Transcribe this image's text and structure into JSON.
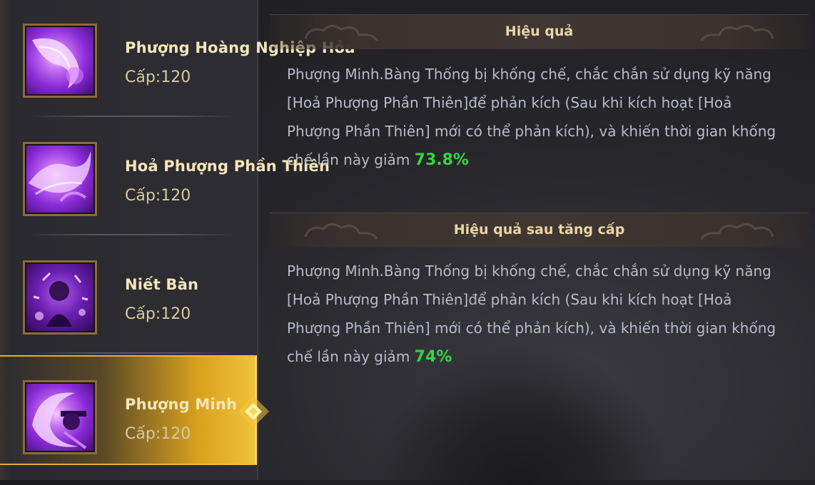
{
  "skills": [
    {
      "name": "Phượng Hoàng Nghiệp Hỏa",
      "level": "Cấp:120",
      "icon": "phoenix-fire-icon"
    },
    {
      "name": "Hoả Phượng Phần Thiên",
      "level": "Cấp:120",
      "icon": "phoenix-wing-icon"
    },
    {
      "name": "Niết Bàn",
      "level": "Cấp:120",
      "icon": "nirvana-icon"
    },
    {
      "name": "Phượng Minh",
      "level": "Cấp:120",
      "icon": "phoenix-cry-icon"
    }
  ],
  "selected_index": 3,
  "effect": {
    "title": "Hiệu quả",
    "text": "Phượng Minh.Bàng Thống bị khống chế, chắc chắn sử dụng kỹ năng [Hoả Phượng Phần Thiên]để phản kích (Sau khi kích hoạt [Hoả Phượng Phần Thiên] mới có thể phản kích), và khiến thời gian khống chế lần này giảm ",
    "value": "73.8%"
  },
  "upgrade_effect": {
    "title": "Hiệu quả sau tăng cấp",
    "text": "Phượng Minh.Bàng Thống bị khống chế, chắc chắn sử dụng kỹ năng [Hoả Phượng Phần Thiên]để phản kích (Sau khi kích hoạt [Hoả Phượng Phần Thiên] mới có thể phản kích), và khiến thời gian khống chế lần này giảm ",
    "value": "74%"
  },
  "colors": {
    "highlight_value": "#35d640",
    "selected_gold": "#d9a21e",
    "title_text": "#e9d6a6"
  }
}
